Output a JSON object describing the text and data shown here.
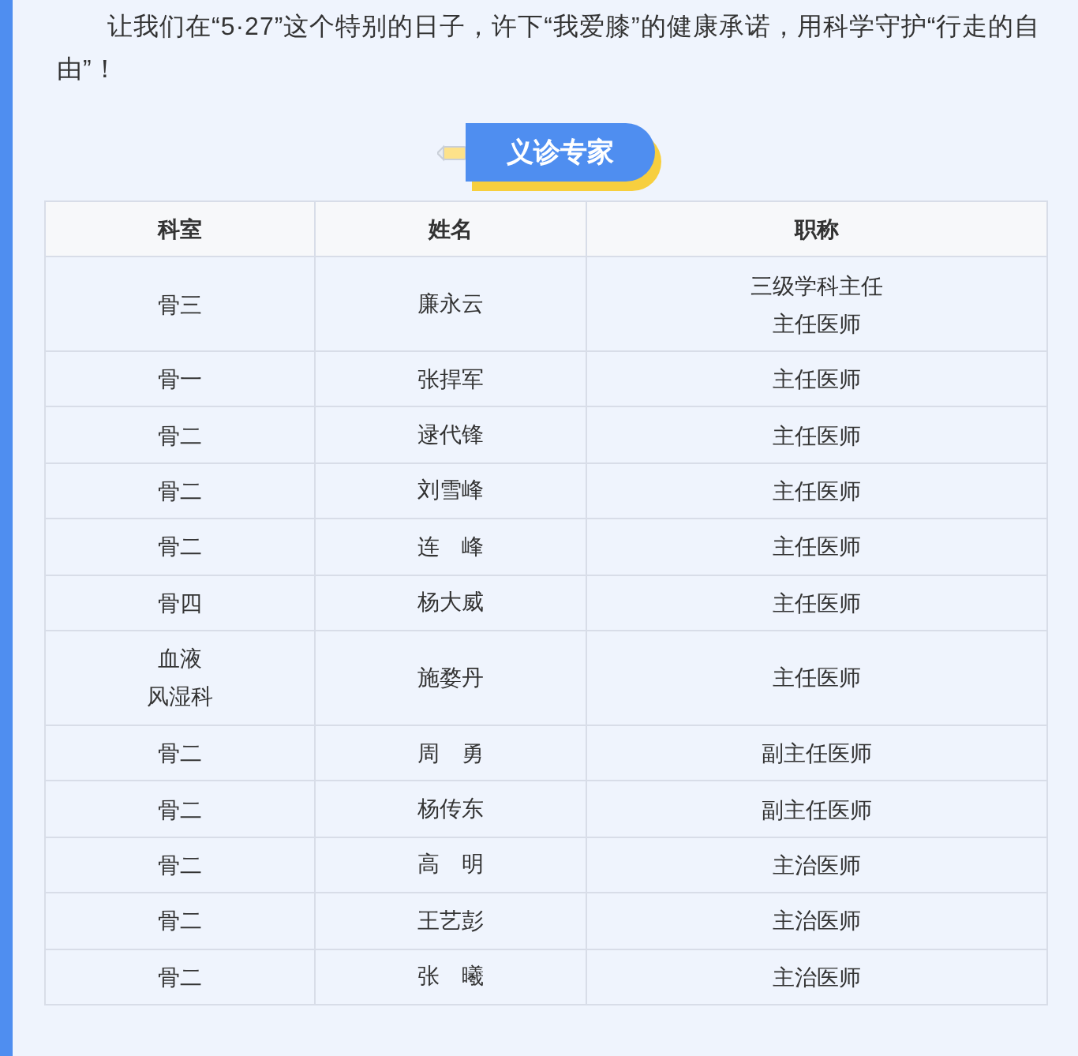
{
  "intro": "让我们在“5·27”这个特别的日子，许下“我爱膝”的健康承诺，用科学守护“行走的自由”！",
  "section_title": "义诊专家",
  "table": {
    "columns": [
      "科室",
      "姓名",
      "职称"
    ],
    "rows": [
      {
        "department": [
          "骨三"
        ],
        "name": "廉永云",
        "title": [
          "三级学科主任",
          "主任医师"
        ]
      },
      {
        "department": [
          "骨一"
        ],
        "name": "张捍军",
        "title": [
          "主任医师"
        ]
      },
      {
        "department": [
          "骨二"
        ],
        "name": "逯代锋",
        "title": [
          "主任医师"
        ]
      },
      {
        "department": [
          "骨二"
        ],
        "name": "刘雪峰",
        "title": [
          "主任医师"
        ]
      },
      {
        "department": [
          "骨二"
        ],
        "name": "连　峰",
        "title": [
          "主任医师"
        ]
      },
      {
        "department": [
          "骨四"
        ],
        "name": "杨大威",
        "title": [
          "主任医师"
        ]
      },
      {
        "department": [
          "血液",
          "风湿科"
        ],
        "name": "施婺丹",
        "title": [
          "主任医师"
        ]
      },
      {
        "department": [
          "骨二"
        ],
        "name": "周　勇",
        "title": [
          "副主任医师"
        ]
      },
      {
        "department": [
          "骨二"
        ],
        "name": "杨传东",
        "title": [
          "副主任医师"
        ]
      },
      {
        "department": [
          "骨二"
        ],
        "name": "高　明",
        "title": [
          "主治医师"
        ]
      },
      {
        "department": [
          "骨二"
        ],
        "name": "王艺彭",
        "title": [
          "主治医师"
        ]
      },
      {
        "department": [
          "骨二"
        ],
        "name": "张　曦",
        "title": [
          "主治医师"
        ]
      }
    ]
  }
}
